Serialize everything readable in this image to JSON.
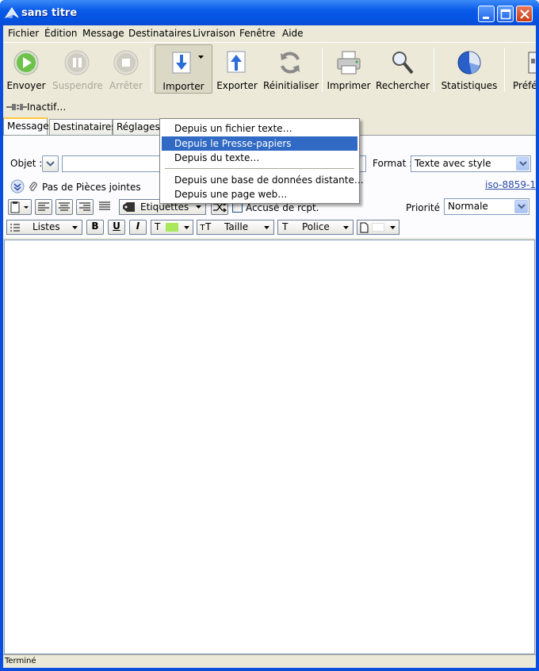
{
  "window": {
    "title": "sans titre"
  },
  "menubar": [
    "Fichier",
    "Édition",
    "Message",
    "Destinataires",
    "Livraison",
    "Fenêtre",
    "Aide"
  ],
  "toolbar": {
    "envoyer": "Envoyer",
    "suspendre": "Suspendre",
    "arreter": "Arrêter",
    "importer": "Importer",
    "exporter": "Exporter",
    "reinitialiser": "Réinitialiser",
    "imprimer": "Imprimer",
    "rechercher": "Rechercher",
    "statistiques": "Statistiques",
    "preferences": "Préfér"
  },
  "status_line": "Inactif…",
  "tabs": [
    "Message",
    "Destinataires",
    "Réglages"
  ],
  "form": {
    "objet_label": "Objet :",
    "format_label": "Format :",
    "format_value": "Texte avec style",
    "attachments": "Pas de Pièces jointes",
    "charset": "iso-8859-1",
    "etiquettes": "Etiquettes",
    "accuse": "Accusé de rcpt.",
    "priorite_label": "Priorité :",
    "priorite_value": "Normale",
    "listes": "Listes",
    "bold": "B",
    "underline": "U",
    "italic": "I",
    "taille": "Taille",
    "police": "Police",
    "text_color": "#a8e85a"
  },
  "import_menu": {
    "items": [
      "Depuis un fichier texte…",
      "Depuis le Presse-papiers",
      "Depuis du texte…",
      "Depuis une base de données distante…",
      "Depuis une page web…"
    ]
  },
  "statusbar": "Terminé"
}
